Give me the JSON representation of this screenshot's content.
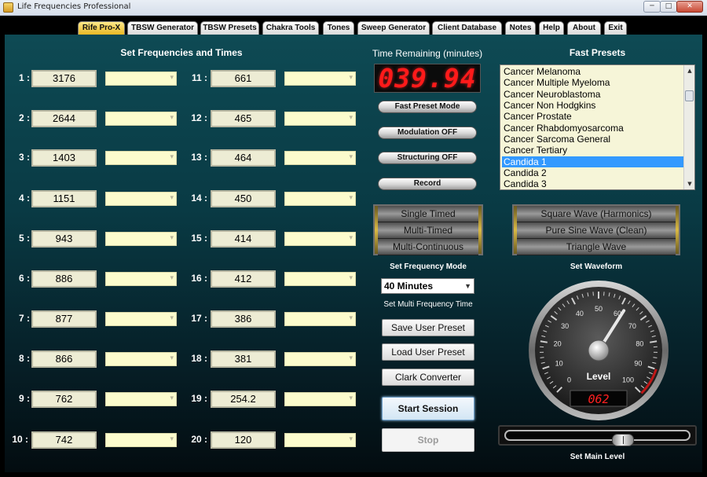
{
  "window": {
    "title": "Life Frequencies Professional",
    "controls": {
      "minimize": "─",
      "maximize": "□",
      "close": "✕"
    }
  },
  "tabs": [
    {
      "label": "Rife Pro-X",
      "active": true
    },
    {
      "label": "TBSW Generator"
    },
    {
      "label": "TBSW Presets"
    },
    {
      "label": "Chakra Tools"
    },
    {
      "label": "Tones"
    },
    {
      "label": "Sweep Generator"
    },
    {
      "label": "Client Database"
    },
    {
      "label": "Notes"
    },
    {
      "label": "Help"
    },
    {
      "label": "About"
    },
    {
      "label": "Exit"
    }
  ],
  "frequencies": {
    "heading": "Set Frequencies and Times",
    "rows": [
      {
        "label": "1 :",
        "value": "3176"
      },
      {
        "label": "2 :",
        "value": "2644"
      },
      {
        "label": "3 :",
        "value": "1403"
      },
      {
        "label": "4 :",
        "value": "1151"
      },
      {
        "label": "5 :",
        "value": "943"
      },
      {
        "label": "6 :",
        "value": "886"
      },
      {
        "label": "7 :",
        "value": "877"
      },
      {
        "label": "8 :",
        "value": "866"
      },
      {
        "label": "9 :",
        "value": "762"
      },
      {
        "label": "10 :",
        "value": "742"
      },
      {
        "label": "11 :",
        "value": "661"
      },
      {
        "label": "12 :",
        "value": "465"
      },
      {
        "label": "13 :",
        "value": "464"
      },
      {
        "label": "14 :",
        "value": "450"
      },
      {
        "label": "15 :",
        "value": "414"
      },
      {
        "label": "16 :",
        "value": "412"
      },
      {
        "label": "17 :",
        "value": "386"
      },
      {
        "label": "18 :",
        "value": "381"
      },
      {
        "label": "19 :",
        "value": "254.2"
      },
      {
        "label": "20 :",
        "value": "120"
      }
    ]
  },
  "timer": {
    "label": "Time Remaining (minutes)",
    "value": "039.94"
  },
  "toggles": {
    "fast_preset_mode": "Fast Preset Mode",
    "modulation": "Modulation OFF",
    "structuring": "Structuring OFF",
    "record": "Record"
  },
  "frequency_mode": {
    "label": "Set Frequency Mode",
    "options": [
      "Single Timed",
      "Multi-Timed",
      "Multi-Continuous"
    ]
  },
  "multi_time": {
    "selected": "40 Minutes",
    "label": "Set Multi Frequency Time"
  },
  "buttons": {
    "save_preset": "Save User Preset",
    "load_preset": "Load User Preset",
    "clark_converter": "Clark Converter",
    "start_session": "Start Session",
    "stop": "Stop"
  },
  "fast_presets": {
    "heading": "Fast Presets",
    "items": [
      "Cancer Melanoma",
      "Cancer Multiple Myeloma",
      "Cancer Neuroblastoma",
      "Cancer Non Hodgkins",
      "Cancer Prostate",
      "Cancer Rhabdomyosarcoma",
      "Cancer Sarcoma General",
      "Cancer Tertiary",
      "Candida 1",
      "Candida 2",
      "Candida 3"
    ],
    "selected": "Candida 1"
  },
  "waveform": {
    "label": "Set Waveform",
    "options": [
      "Square Wave (Harmonics)",
      "Pure Sine Wave (Clean)",
      "Triangle Wave"
    ]
  },
  "level": {
    "gauge_label": "Level",
    "readout": "062",
    "value": 62,
    "scale": [
      "0",
      "10",
      "20",
      "30",
      "40",
      "50",
      "60",
      "70",
      "80",
      "90",
      "100"
    ],
    "slider_label": "Set Main Level"
  },
  "colors": {
    "timer_red": "#ff1a1a",
    "selection_blue": "#3399ff",
    "time_field_yellow": "#fcfccd",
    "active_tab_gold": "#e8b824",
    "panel_teal": "#0e4a54"
  }
}
